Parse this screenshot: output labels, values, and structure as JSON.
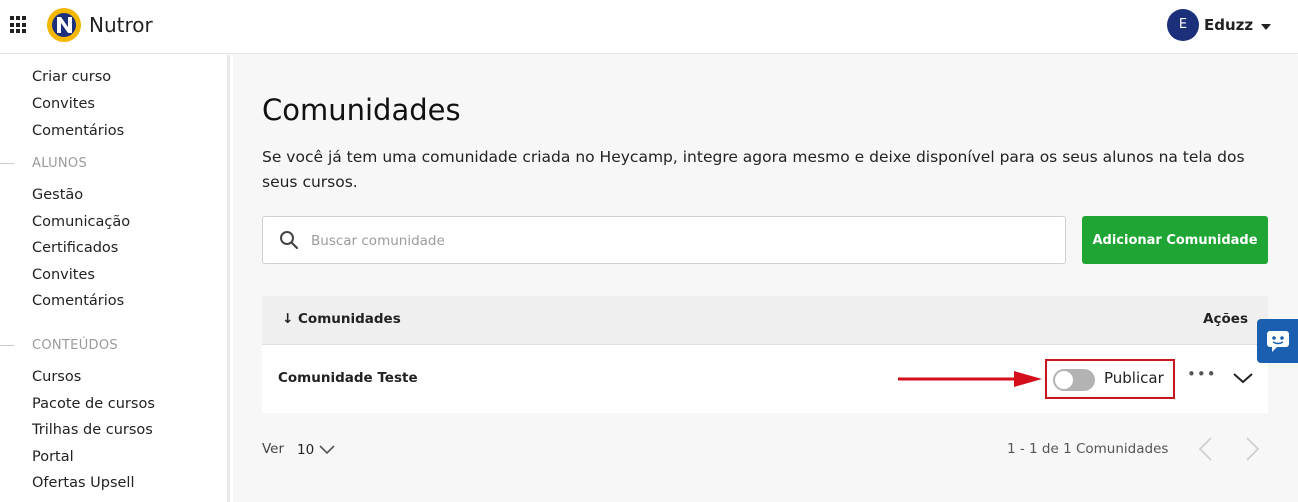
{
  "topbar": {
    "brand": "Nutror",
    "user_initial": "E",
    "user_name": "Eduzz"
  },
  "sidebar": {
    "top_items": [
      "Criar curso",
      "Convites",
      "Comentários"
    ],
    "alunos_title": "ALUNOS",
    "alunos_items": [
      "Gestão",
      "Comunicação",
      "Certificados",
      "Convites",
      "Comentários"
    ],
    "conteudos_title": "CONTEÚDOS",
    "conteudos_items": [
      "Cursos",
      "Pacote de cursos",
      "Trilhas de cursos",
      "Portal",
      "Ofertas Upsell"
    ]
  },
  "main": {
    "title": "Comunidades",
    "description": "Se você já tem uma comunidade criada no Heycamp, integre agora mesmo e deixe disponível para os seus alunos na tela dos seus cursos.",
    "search_placeholder": "Buscar comunidade",
    "add_button": "Adicionar Comunidade",
    "table": {
      "col_name": "↓ Comunidades",
      "col_actions": "Ações",
      "rows": [
        {
          "name": "Comunidade Teste",
          "publish_label": "Publicar",
          "published": false
        }
      ]
    },
    "footer": {
      "per_page_label": "Ver",
      "per_page_value": "10",
      "pagination_info": "1 - 1 de 1 Comunidades"
    }
  },
  "colors": {
    "accent_green": "#1ea534",
    "highlight_red": "#c8161d",
    "avatar_blue": "#1b2f7a",
    "chat_blue": "#1b5fb0"
  },
  "icons": [
    "apps-grid-icon",
    "nutror-logo",
    "chevron-down-icon",
    "search-icon",
    "more-horizontal-icon",
    "chevron-left-icon",
    "chevron-right-icon",
    "chat-icon"
  ]
}
